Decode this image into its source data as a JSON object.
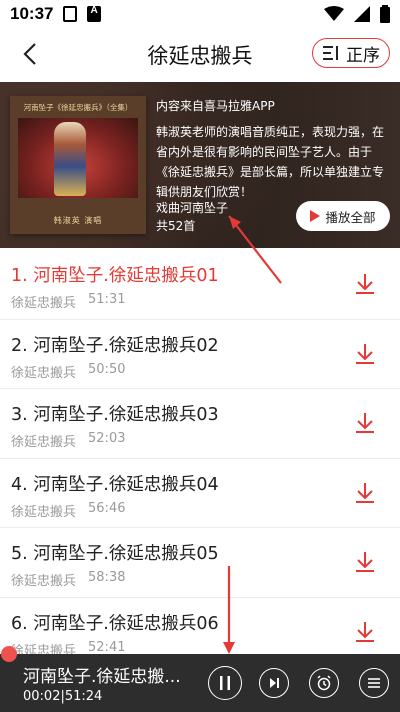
{
  "status_bar": {
    "time": "10:37"
  },
  "header": {
    "title": "徐延忠搬兵",
    "sort_label": "正序"
  },
  "album": {
    "cover_caption": "河南坠子《徐延忠搬兵》（全集）",
    "cover_sub": "韩淑英  演唱",
    "source": "内容来自喜马拉雅APP",
    "description": "韩淑英老师的演唱音质纯正，表现力强，在省内外是很有影响的民间坠子艺人。由于《徐延忠搬兵》是部长篇，所以单独建立专辑供朋友们欣赏！",
    "category": "戏曲河南坠子",
    "count": "共52首",
    "play_all_label": "播放全部"
  },
  "tracks": [
    {
      "title": "1. 河南坠子.徐延忠搬兵01",
      "album": "徐延忠搬兵",
      "duration": "51:31",
      "active": true
    },
    {
      "title": "2. 河南坠子.徐延忠搬兵02",
      "album": "徐延忠搬兵",
      "duration": "50:50",
      "active": false
    },
    {
      "title": "3. 河南坠子.徐延忠搬兵03",
      "album": "徐延忠搬兵",
      "duration": "52:03",
      "active": false
    },
    {
      "title": "4. 河南坠子.徐延忠搬兵04",
      "album": "徐延忠搬兵",
      "duration": "56:46",
      "active": false
    },
    {
      "title": "5. 河南坠子.徐延忠搬兵05",
      "album": "徐延忠搬兵",
      "duration": "58:38",
      "active": false
    },
    {
      "title": "6. 河南坠子.徐延忠搬兵06",
      "album": "徐延忠搬兵",
      "duration": "52:41",
      "active": false
    }
  ],
  "player": {
    "now_playing": "河南坠子.徐延忠搬...",
    "time": "00:02|51:24"
  },
  "colors": {
    "accent": "#e53935",
    "player_bg": "#2d2d2d"
  }
}
